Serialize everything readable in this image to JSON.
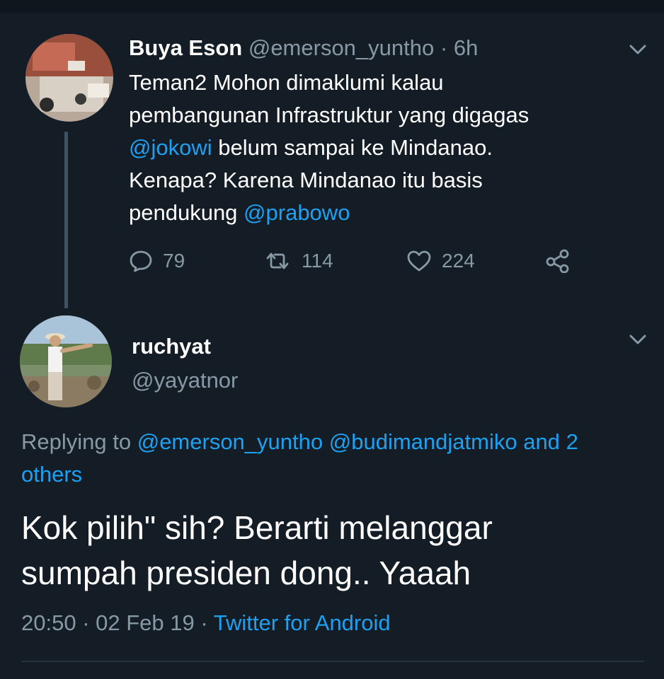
{
  "parent_tweet": {
    "display_name": "Buya Eson",
    "handle": "@emerson_yuntho",
    "separator": "·",
    "time": "6h",
    "body": [
      [
        {
          "t": "Teman2 Mohon dimaklumi kalau",
          "m": false
        }
      ],
      [
        {
          "t": "pembangunan Infrastruktur yang digagas",
          "m": false
        }
      ],
      [
        {
          "t": "@jokowi",
          "m": true
        },
        {
          "t": " belum sampai ke Mindanao.",
          "m": false
        }
      ],
      [
        {
          "t": "Kenapa? Karena Mindanao itu basis",
          "m": false
        }
      ],
      [
        {
          "t": "pendukung ",
          "m": false
        },
        {
          "t": "@prabowo",
          "m": true
        }
      ]
    ],
    "actions": {
      "replies": "79",
      "retweets": "114",
      "likes": "224",
      "reply_icon": "comment-bubble-icon",
      "retweet_icon": "retweet-icon",
      "like_icon": "heart-icon",
      "share_icon": "share-icon"
    }
  },
  "reply_tweet": {
    "display_name": "ruchyat",
    "handle": "@yayatnor",
    "replying_prefix": "Replying to ",
    "replying_mentions": [
      "@emerson_yuntho",
      "@budimandjatmiko"
    ],
    "replying_suffix": "and",
    "replying_others": "2 others",
    "text_lines": [
      "Kok pilih\" sih? Berarti melanggar",
      "sumpah presiden dong.. Yaaah"
    ],
    "time": "20:50",
    "separator": "·",
    "date": "02 Feb 19",
    "source": "Twitter for Android"
  },
  "colors": {
    "background": "#141d26",
    "text": "#ffffff",
    "secondary": "#8899a6",
    "link": "#1da1f2"
  }
}
